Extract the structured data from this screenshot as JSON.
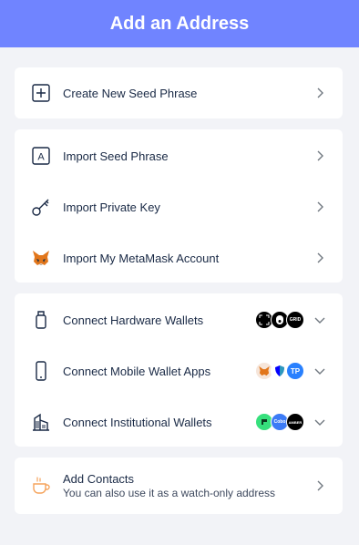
{
  "header": {
    "title": "Add an Address"
  },
  "create": {
    "label": "Create New Seed Phrase"
  },
  "import": {
    "items": [
      {
        "label": "Import Seed Phrase"
      },
      {
        "label": "Import Private Key"
      },
      {
        "label": "Import My MetaMask Account"
      }
    ]
  },
  "connect": {
    "items": [
      {
        "label": "Connect Hardware Wallets",
        "badges": [
          "ledger",
          "onekey",
          "gridplus"
        ]
      },
      {
        "label": "Connect Mobile Wallet Apps",
        "badges": [
          "metamask",
          "trust",
          "tokenpocket"
        ]
      },
      {
        "label": "Connect Institutional Wallets",
        "badges": [
          "cactus",
          "cobo",
          "amber"
        ]
      }
    ],
    "badge_text": {
      "gridplus": "GRID",
      "cobo": "Cobo",
      "amber": "AMBER",
      "tokenpocket": "TP"
    }
  },
  "contacts": {
    "title": "Add Contacts",
    "subtitle": "You can also use it as a watch-only address"
  },
  "colors": {
    "header": "#7084ff",
    "background": "#f2f3f7",
    "text": "#192945",
    "contacts_icon": "#f5a35c",
    "chevron": "#707880"
  }
}
